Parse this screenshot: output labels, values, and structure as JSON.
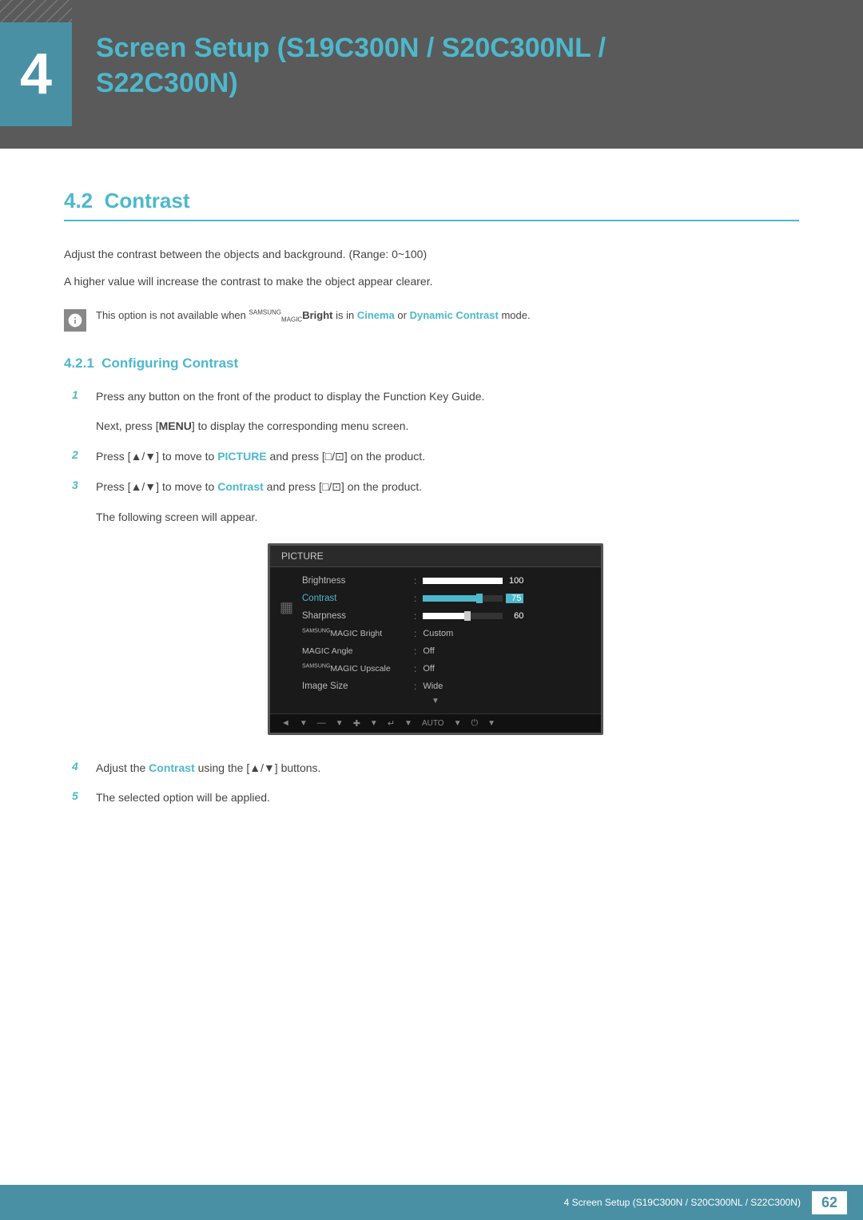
{
  "header": {
    "chapter_number": "4",
    "title_line1": "Screen Setup (S19C300N / S20C300NL /",
    "title_line2": "S22C300N)"
  },
  "section": {
    "number": "4.2",
    "title": "Contrast",
    "desc1": "Adjust the contrast between the objects and background. (Range: 0~100)",
    "desc2": "A higher value will increase the contrast to make the object appear clearer.",
    "note": "This option is not available when ",
    "note_brand_super": "SAMSUNG",
    "note_brand_sub": "MAGIC",
    "note_brand_word": "Bright",
    "note_mid": " is in ",
    "note_cyan1": "Cinema",
    "note_or": " or ",
    "note_cyan2": "Dynamic Contrast",
    "note_end": " mode.",
    "subsection_number": "4.2.1",
    "subsection_title": "Configuring Contrast"
  },
  "steps": [
    {
      "number": "1",
      "line1": "Press any button on the front of the product to display the Function Key Guide.",
      "line2": "Next, press [",
      "line2_bold": "MENU",
      "line2_end": "] to display the corresponding menu screen."
    },
    {
      "number": "2",
      "text_before": "Press [▲/▼] to move to ",
      "text_bold": "PICTURE",
      "text_after": " and press [□/⊡] on the product."
    },
    {
      "number": "3",
      "text_before": "Press [▲/▼] to move to ",
      "text_bold": "Contrast",
      "text_after": " and press [□/⊡] on the product.",
      "sub": "The following screen will appear."
    },
    {
      "number": "4",
      "text_before": "Adjust the ",
      "text_bold": "Contrast",
      "text_after": " using the [▲/▼] buttons."
    },
    {
      "number": "5",
      "text": "The selected option will be applied."
    }
  ],
  "monitor": {
    "header_label": "PICTURE",
    "menu_items": [
      {
        "label": "Brightness",
        "type": "bar",
        "fill_pct": 100,
        "value": "100",
        "active": false
      },
      {
        "label": "Contrast",
        "type": "bar_cyan",
        "fill_pct": 75,
        "value": "75",
        "active": true
      },
      {
        "label": "Sharpness",
        "type": "bar",
        "fill_pct": 60,
        "value": "60",
        "active": false
      },
      {
        "label": "SAMSUNG MAGIC Bright",
        "type": "value",
        "value": "Custom",
        "active": false
      },
      {
        "label": "MAGIC Angle",
        "type": "value",
        "value": "Off",
        "active": false
      },
      {
        "label": "SAMSUNG MAGIC Upscale",
        "type": "value",
        "value": "Off",
        "active": false
      },
      {
        "label": "Image Size",
        "type": "value",
        "value": "Wide",
        "active": false
      }
    ],
    "bottom_icons": [
      "◄",
      "—",
      "✚",
      "↵",
      "AUTO",
      "⏻"
    ]
  },
  "footer": {
    "text": "4 Screen Setup (S19C300N / S20C300NL / S22C300N)",
    "page": "62"
  }
}
